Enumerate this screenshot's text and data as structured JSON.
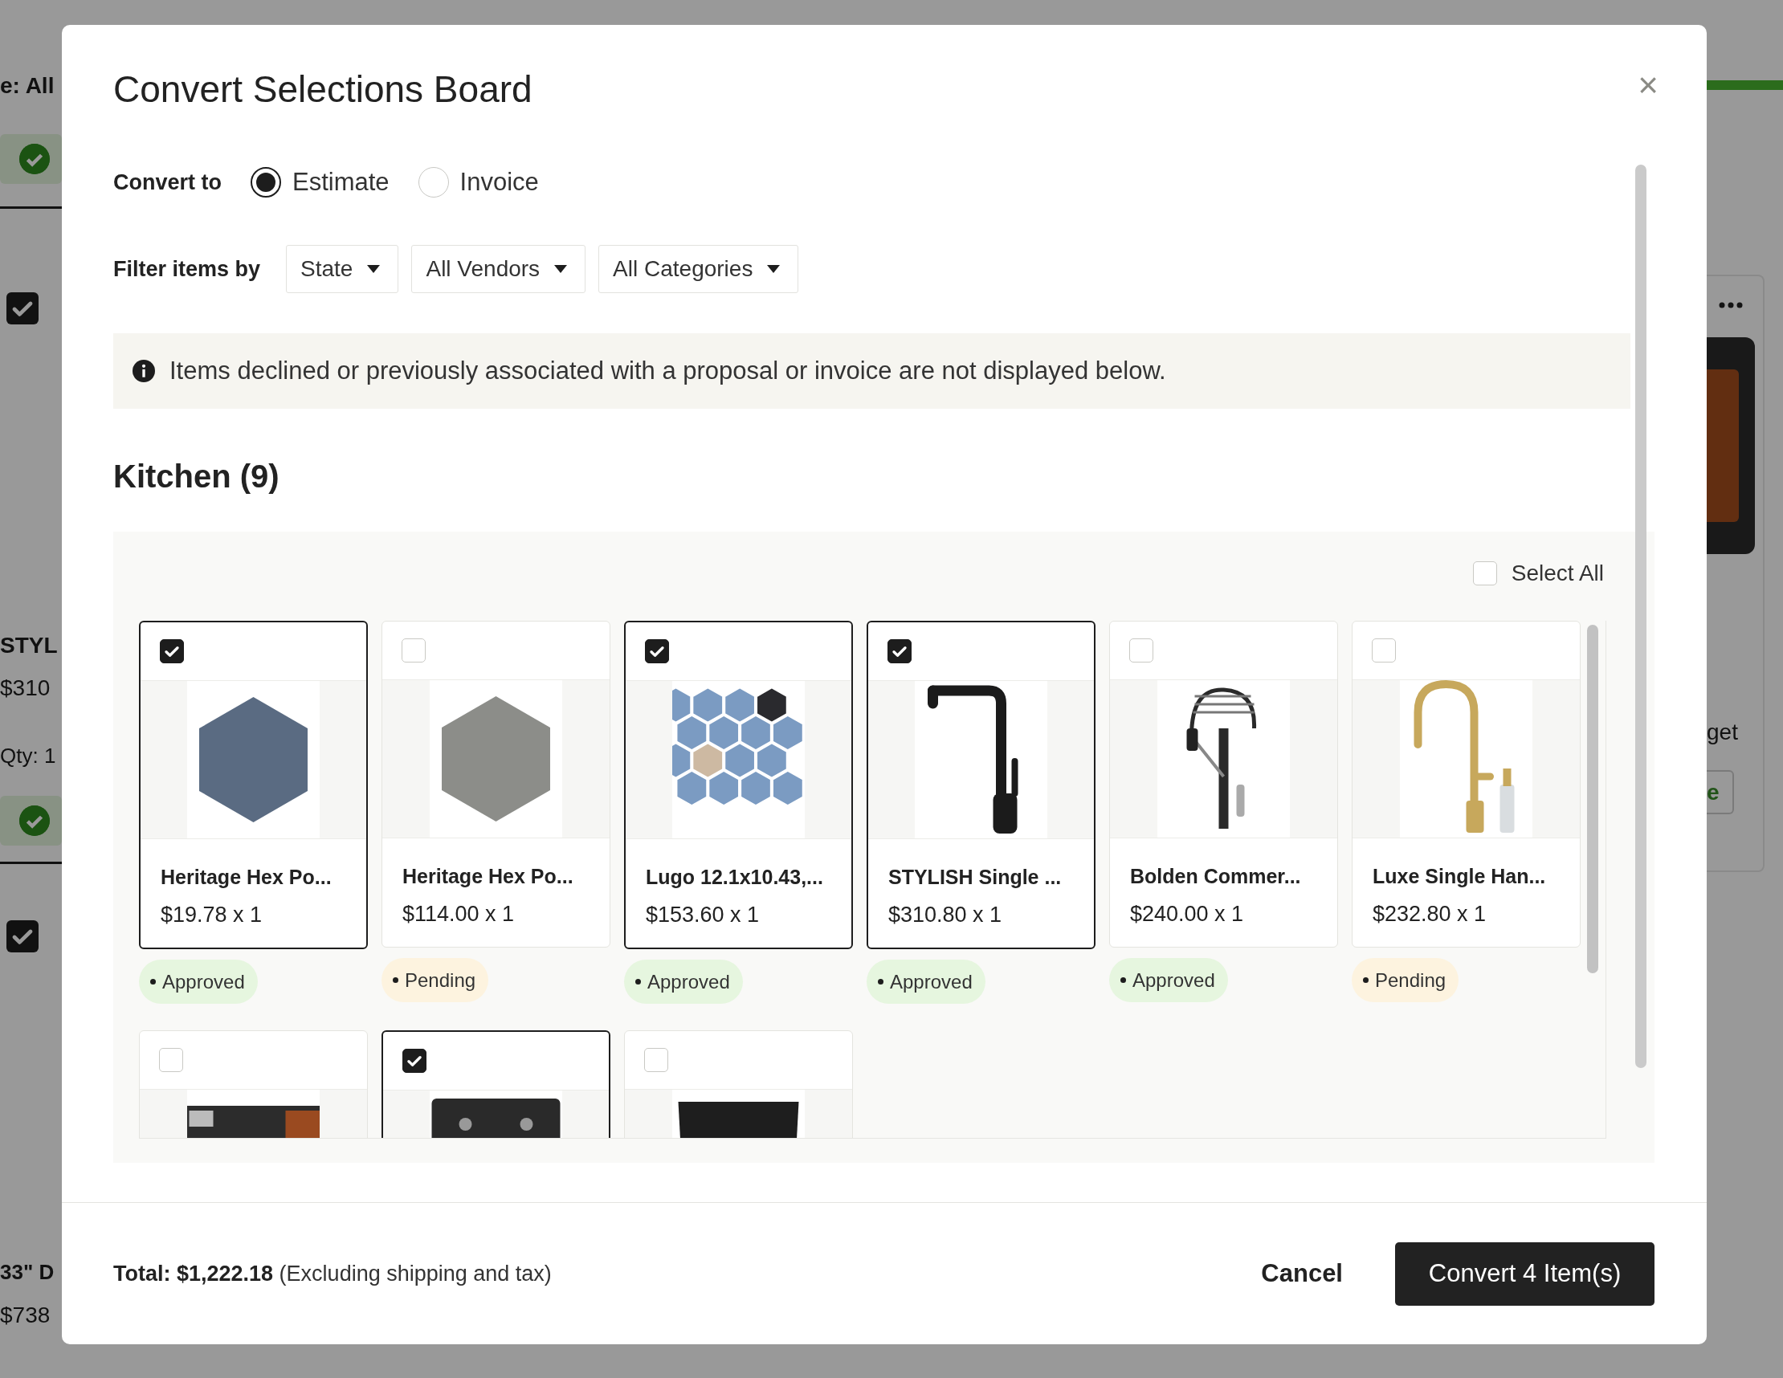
{
  "background": {
    "filter_label": "e: All",
    "items": [
      {
        "checked": true,
        "name": "STYL",
        "price": "$310",
        "qty": "Qty: 1"
      },
      {
        "checked": true,
        "name": "33\" D",
        "price": "$738"
      }
    ],
    "side_text": "get",
    "side_button": "e"
  },
  "modal": {
    "title": "Convert Selections Board",
    "close": "×",
    "convert_to": {
      "label": "Convert to",
      "options": [
        {
          "label": "Estimate",
          "selected": true
        },
        {
          "label": "Invoice",
          "selected": false
        }
      ]
    },
    "filter": {
      "label": "Filter items by",
      "dropdowns": [
        "State",
        "All Vendors",
        "All Categories"
      ]
    },
    "notice": "Items declined or previously associated with a proposal or invoice are not displayed below.",
    "section": {
      "title": "Kitchen (9)",
      "select_all": {
        "label": "Select All",
        "checked": false
      },
      "items": [
        {
          "kind": "hextile",
          "selected": true,
          "name": "Heritage Hex Po...",
          "price": "$19.78 x 1",
          "status": {
            "label": "Approved",
            "color": "#e6f6df"
          }
        },
        {
          "kind": "hexstone",
          "selected": false,
          "name": "Heritage Hex Po...",
          "price": "$114.00 x 1",
          "status": {
            "label": "Pending",
            "color": "#fdf3df"
          }
        },
        {
          "kind": "mosaic",
          "selected": true,
          "name": "Lugo 12.1x10.43,...",
          "price": "$153.60 x 1",
          "status": {
            "label": "Approved",
            "color": "#e6f6df"
          }
        },
        {
          "kind": "faucet",
          "selected": true,
          "name": "STYLISH Single ...",
          "price": "$310.80 x 1",
          "status": {
            "label": "Approved",
            "color": "#e6f6df"
          }
        },
        {
          "kind": "springfaucet",
          "selected": false,
          "name": "Bolden Commer...",
          "price": "$240.00 x 1",
          "status": {
            "label": "Approved",
            "color": "#e6f6df"
          }
        },
        {
          "kind": "barfaucet",
          "selected": false,
          "name": "Luxe Single Han...",
          "price": "$232.80 x 1",
          "status": {
            "label": "Pending",
            "color": "#fdf3df"
          }
        },
        {
          "kind": "workstationsink",
          "selected": false
        },
        {
          "kind": "doublesink",
          "selected": true
        },
        {
          "kind": "singlesink",
          "selected": false
        }
      ]
    },
    "footer": {
      "total": "**Total: $1,222.18** (Excluding shipping and tax)",
      "cancel": "Cancel",
      "convert": "Convert 4 Item(s)"
    }
  }
}
